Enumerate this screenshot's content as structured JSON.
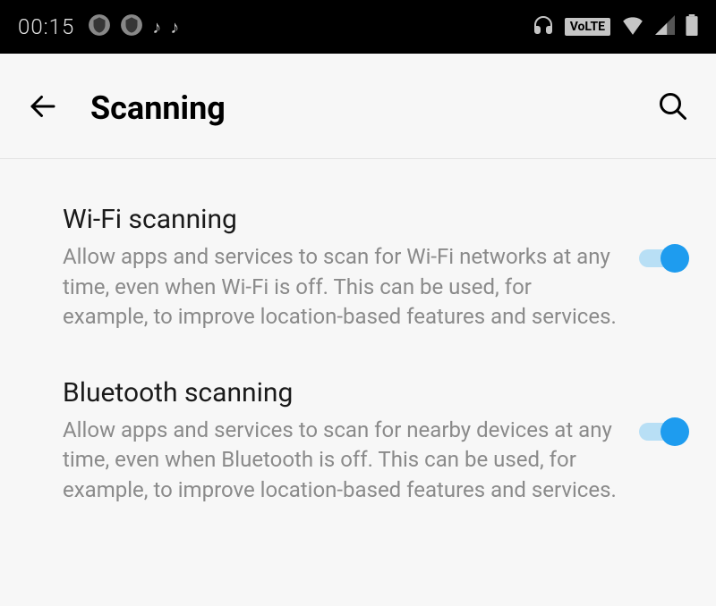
{
  "statusBar": {
    "time": "00:15",
    "volte": "VoLTE"
  },
  "header": {
    "title": "Scanning"
  },
  "settings": {
    "wifi": {
      "title": "Wi-Fi scanning",
      "description": "Allow apps and services to scan for Wi-Fi networks at any time, even when Wi-Fi is off. This can be used, for example, to improve location-based features and services.",
      "enabled": true
    },
    "bluetooth": {
      "title": "Bluetooth scanning",
      "description": "Allow apps and services to scan for nearby devices at any time, even when Bluetooth is off. This can be used, for example, to improve location-based features and services.",
      "enabled": true
    }
  }
}
